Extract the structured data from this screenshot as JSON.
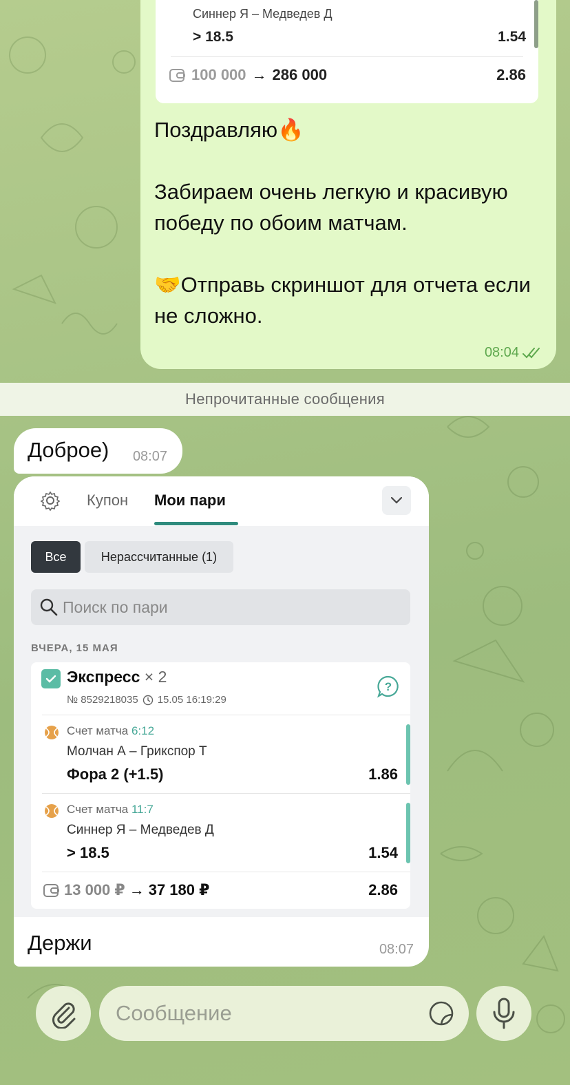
{
  "top_receipt": {
    "match": "Синнер Я – Медведев Д",
    "pick": "> 18.5",
    "odd": "1.54",
    "stake_from": "100 000",
    "arrow": "→",
    "stake_to": "286 000",
    "total_odd": "2.86"
  },
  "outgoing_message": {
    "lines": [
      "Поздравляю🔥",
      "",
      "Забираем очень легкую и красивую победу по обоим матчам.",
      "",
      "🤝Отправь скриншот для отчета если не сложно."
    ],
    "time": "08:04"
  },
  "unread_divider": "Непрочитанные сообщения",
  "incoming_small": {
    "text": "Доброе)",
    "time": "08:07"
  },
  "incoming_big": {
    "screenshot": {
      "tab_coupon": "Купон",
      "tab_mine": "Мои пари",
      "filter_all": "Все",
      "filter_unsettled": "Нерассчитанные (1)",
      "search_placeholder": "Поиск по пари",
      "date_label": "ВЧЕРА, 15 МАЯ",
      "express_title": "Экспресс",
      "express_mult": "× 2",
      "bet_number": "№ 8529218035",
      "bet_datetime": "15.05 16:19:29",
      "legs": [
        {
          "score_label": "Счет матча",
          "score": "6:12",
          "teams": "Молчан А – Грикспор Т",
          "pick": "Фора 2 (+1.5)",
          "odd": "1.86"
        },
        {
          "score_label": "Счет матча",
          "score": "11:7",
          "teams": "Синнер Я – Медведев Д",
          "pick": "> 18.5",
          "odd": "1.54"
        }
      ],
      "stake_from": "13 000 ₽",
      "arrow": "→",
      "stake_to": "37 180 ₽",
      "total_odd": "2.86"
    },
    "caption": "Держи",
    "time": "08:07"
  },
  "composer": {
    "placeholder": "Сообщение"
  },
  "colors": {
    "accent_green": "#47a897",
    "outgoing_bg": "#e3f9c8",
    "check_color": "#5ea84e"
  }
}
